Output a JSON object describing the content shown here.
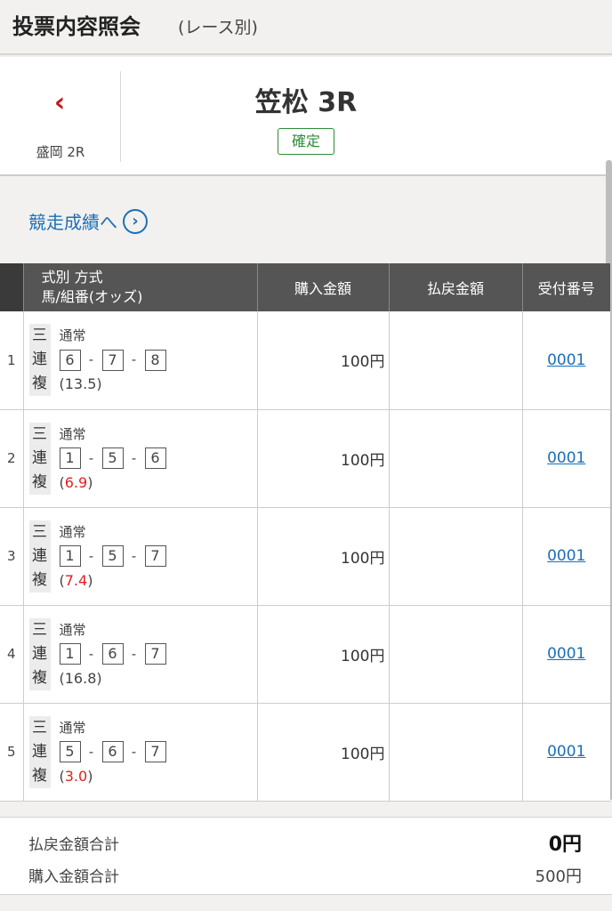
{
  "header": {
    "title": "投票内容照会",
    "subtitle": "(レース別)"
  },
  "race": {
    "prev_label": "盛岡 2R",
    "name": "笠松 3R",
    "status": "確定",
    "result_link": "競走成績へ"
  },
  "table": {
    "headers": {
      "type_line1": "式別 方式",
      "type_line2": "馬/組番(オッズ)",
      "buy": "購入金額",
      "payout": "払戻金額",
      "receipt": "受付番号"
    },
    "rows": [
      {
        "idx": "1",
        "type": [
          "三",
          "連",
          "複"
        ],
        "method": "通常",
        "nums": [
          "6",
          "7",
          "8"
        ],
        "odds": "13.5",
        "odds_red": false,
        "buy": "100円",
        "payout": "",
        "receipt": "0001"
      },
      {
        "idx": "2",
        "type": [
          "三",
          "連",
          "複"
        ],
        "method": "通常",
        "nums": [
          "1",
          "5",
          "6"
        ],
        "odds": "6.9",
        "odds_red": true,
        "buy": "100円",
        "payout": "",
        "receipt": "0001"
      },
      {
        "idx": "3",
        "type": [
          "三",
          "連",
          "複"
        ],
        "method": "通常",
        "nums": [
          "1",
          "5",
          "7"
        ],
        "odds": "7.4",
        "odds_red": true,
        "buy": "100円",
        "payout": "",
        "receipt": "0001"
      },
      {
        "idx": "4",
        "type": [
          "三",
          "連",
          "複"
        ],
        "method": "通常",
        "nums": [
          "1",
          "6",
          "7"
        ],
        "odds": "16.8",
        "odds_red": false,
        "buy": "100円",
        "payout": "",
        "receipt": "0001"
      },
      {
        "idx": "5",
        "type": [
          "三",
          "連",
          "複"
        ],
        "method": "通常",
        "nums": [
          "5",
          "6",
          "7"
        ],
        "odds": "3.0",
        "odds_red": true,
        "buy": "100円",
        "payout": "",
        "receipt": "0001"
      }
    ]
  },
  "summary": {
    "payout_label": "払戻金額合計",
    "payout_value": "0円",
    "buy_label": "購入金額合計",
    "buy_value": "500円"
  },
  "colors": {
    "accent_red": "#c4161c",
    "link_blue": "#1a6fb8",
    "confirmed_green": "#2e8b3a",
    "odds_red": "#e0201c"
  }
}
